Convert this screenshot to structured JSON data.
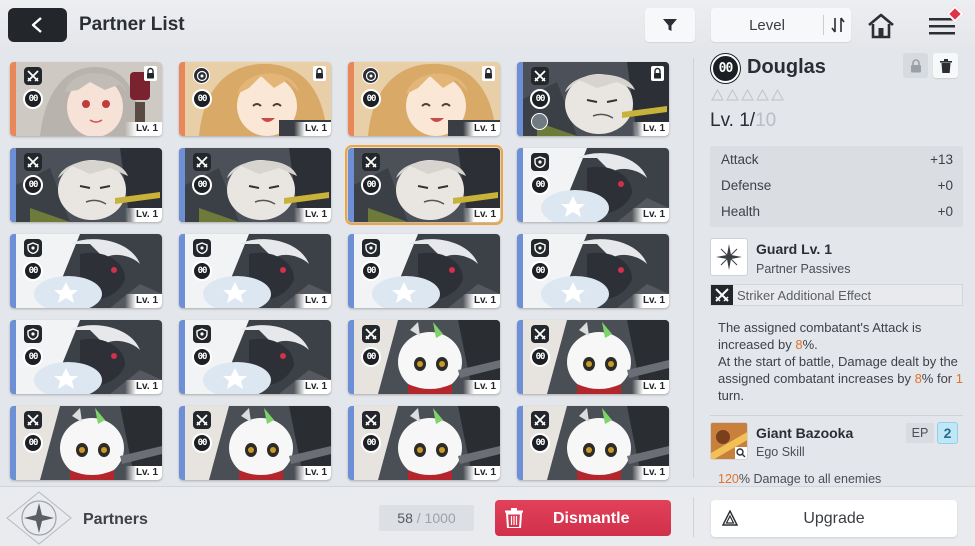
{
  "header": {
    "title": "Partner List",
    "sort_label": "Level"
  },
  "icons": {
    "back": "back-arrow-icon",
    "filter": "filter-funnel-icon",
    "sort_order": "sort-order-icon",
    "home": "home-icon",
    "menu": "hamburger-menu-icon"
  },
  "colors": {
    "accent_red": "#d6344d",
    "selected_outline": "#f0a43a",
    "highlight_orange": "#e2732a",
    "ep_blue": "#bfe7f7",
    "dark": "#23262b"
  },
  "cards": [
    {
      "portrait": "silver-haired-girl",
      "class": "striker",
      "rank": "00",
      "level": "Lv. 1",
      "locked": true,
      "stripe": "#e8875a"
    },
    {
      "portrait": "blonde-girl",
      "class": "balance",
      "rank": "00",
      "level": "Lv. 1",
      "locked": true,
      "stripe": "#e8875a"
    },
    {
      "portrait": "blonde-girl",
      "class": "balance",
      "rank": "00",
      "level": "Lv. 1",
      "locked": true,
      "stripe": "#e8875a"
    },
    {
      "portrait": "dark-armored",
      "class": "striker",
      "rank": "00",
      "level": "Lv. 1",
      "locked": true,
      "stripe": "#6d8fd6",
      "extra": true
    },
    {
      "portrait": "dark-armored",
      "class": "striker",
      "rank": "00",
      "level": "Lv. 1",
      "locked": false,
      "stripe": "#6d8fd6"
    },
    {
      "portrait": "dark-armored",
      "class": "striker",
      "rank": "00",
      "level": "Lv. 1",
      "locked": false,
      "stripe": "#6d8fd6"
    },
    {
      "portrait": "dark-armored",
      "class": "striker",
      "rank": "00",
      "level": "Lv. 1",
      "locked": false,
      "stripe": "#6d8fd6",
      "selected": true
    },
    {
      "portrait": "white-beast",
      "class": "defender",
      "rank": "00",
      "level": "Lv. 1",
      "locked": false,
      "stripe": "#6d8fd6"
    },
    {
      "portrait": "white-beast",
      "class": "defender",
      "rank": "00",
      "level": "Lv. 1",
      "locked": false,
      "stripe": "#6d8fd6"
    },
    {
      "portrait": "white-beast",
      "class": "defender",
      "rank": "00",
      "level": "Lv. 1",
      "locked": false,
      "stripe": "#6d8fd6"
    },
    {
      "portrait": "white-beast",
      "class": "defender",
      "rank": "00",
      "level": "Lv. 1",
      "locked": false,
      "stripe": "#6d8fd6"
    },
    {
      "portrait": "white-beast",
      "class": "defender",
      "rank": "00",
      "level": "Lv. 1",
      "locked": false,
      "stripe": "#6d8fd6"
    },
    {
      "portrait": "white-beast",
      "class": "defender",
      "rank": "00",
      "level": "Lv. 1",
      "locked": false,
      "stripe": "#6d8fd6"
    },
    {
      "portrait": "white-beast",
      "class": "defender",
      "rank": "00",
      "level": "Lv. 1",
      "locked": false,
      "stripe": "#6d8fd6"
    },
    {
      "portrait": "white-mascot",
      "class": "striker",
      "rank": "00",
      "level": "Lv. 1",
      "locked": false,
      "stripe": "#6d8fd6"
    },
    {
      "portrait": "white-mascot",
      "class": "striker",
      "rank": "00",
      "level": "Lv. 1",
      "locked": false,
      "stripe": "#6d8fd6"
    },
    {
      "portrait": "white-mascot",
      "class": "striker",
      "rank": "00",
      "level": "Lv. 1",
      "locked": false,
      "stripe": "#6d8fd6"
    },
    {
      "portrait": "white-mascot",
      "class": "striker",
      "rank": "00",
      "level": "Lv. 1",
      "locked": false,
      "stripe": "#6d8fd6"
    },
    {
      "portrait": "white-mascot",
      "class": "striker",
      "rank": "00",
      "level": "Lv. 1",
      "locked": false,
      "stripe": "#6d8fd6"
    },
    {
      "portrait": "white-mascot",
      "class": "striker",
      "rank": "00",
      "level": "Lv. 1",
      "locked": false,
      "stripe": "#6d8fd6"
    }
  ],
  "detail": {
    "rank": "00",
    "name": "Douglas",
    "level_current": "Lv. 1/",
    "level_max": "10",
    "stats": [
      {
        "label": "Attack",
        "value": "+13"
      },
      {
        "label": "Defense",
        "value": "+0"
      },
      {
        "label": "Health",
        "value": "+0"
      }
    ],
    "passive": {
      "title": "Guard Lv. 1",
      "subtitle": "Partner Passives",
      "effect_label": "Striker Additional Effect",
      "desc": {
        "p1": "The assigned combatant's Attack is increased by ",
        "v1": "8",
        "p2": "%.",
        "p3": "At the start of battle, Damage dealt by the assigned combatant increases by ",
        "v2": "8",
        "p4": "% for ",
        "v3": "1",
        "p5": " turn."
      }
    },
    "skill": {
      "title": "Giant Bazooka",
      "subtitle": "Ego Skill",
      "ep_label": "EP",
      "ep_value": "2",
      "desc_value": "120",
      "desc_text": "% Damage to all enemies"
    }
  },
  "footer": {
    "partners_label": "Partners",
    "count_current": "58",
    "count_max": " / 1000",
    "dismantle_label": "Dismantle",
    "upgrade_label": "Upgrade"
  }
}
